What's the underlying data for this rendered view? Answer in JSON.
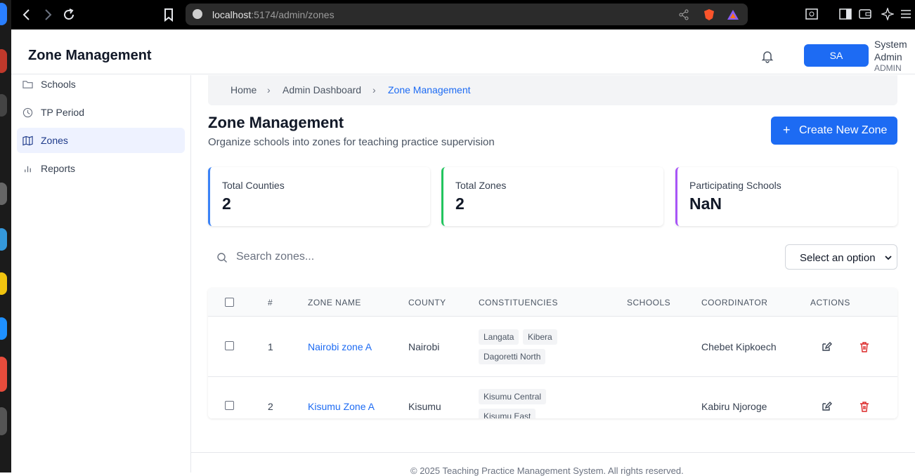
{
  "browser": {
    "url_host": "localhost",
    "url_path": ":5174/admin/zones"
  },
  "header": {
    "title": "Zone Management",
    "avatar_initials": "SA",
    "user_name": "System Admin",
    "user_role": "ADMIN"
  },
  "sidebar": {
    "items": [
      {
        "label": "Schools",
        "icon": "folder-icon",
        "active": false
      },
      {
        "label": "TP Period",
        "icon": "clock-icon",
        "active": false
      },
      {
        "label": "Zones",
        "icon": "map-icon",
        "active": true
      },
      {
        "label": "Reports",
        "icon": "bar-chart-icon",
        "active": false
      }
    ]
  },
  "breadcrumb": [
    "Home",
    "Admin Dashboard",
    "Zone Management"
  ],
  "page": {
    "title": "Zone Management",
    "subtitle": "Organize schools into zones for teaching practice supervision",
    "create_button": "Create New Zone"
  },
  "stats": [
    {
      "label": "Total Counties",
      "value": "2",
      "color": "#3b82f6"
    },
    {
      "label": "Total Zones",
      "value": "2",
      "color": "#22c55e"
    },
    {
      "label": "Participating Schools",
      "value": "NaN",
      "color": "#a855f7"
    }
  ],
  "filters": {
    "search_placeholder": "Search zones...",
    "select_value": "Select an option"
  },
  "table": {
    "headers": [
      "#",
      "ZONE NAME",
      "COUNTY",
      "CONSTITUENCIES",
      "SCHOOLS",
      "COORDINATOR",
      "ACTIONS"
    ],
    "rows": [
      {
        "num": "1",
        "zone": "Nairobi zone A",
        "county": "Nairobi",
        "constituencies": [
          "Langata",
          "Kibera",
          "Dagoretti North"
        ],
        "schools": "",
        "coordinator": "Chebet Kipkoech"
      },
      {
        "num": "2",
        "zone": "Kisumu Zone A",
        "county": "Kisumu",
        "constituencies": [
          "Kisumu Central",
          "Kisumu East"
        ],
        "schools": "",
        "coordinator": "Kabiru Njoroge"
      }
    ]
  },
  "footer": "© 2025 Teaching Practice Management System. All rights reserved.",
  "colors": {
    "accent": "#1d6bf3",
    "danger": "#dc2626"
  }
}
